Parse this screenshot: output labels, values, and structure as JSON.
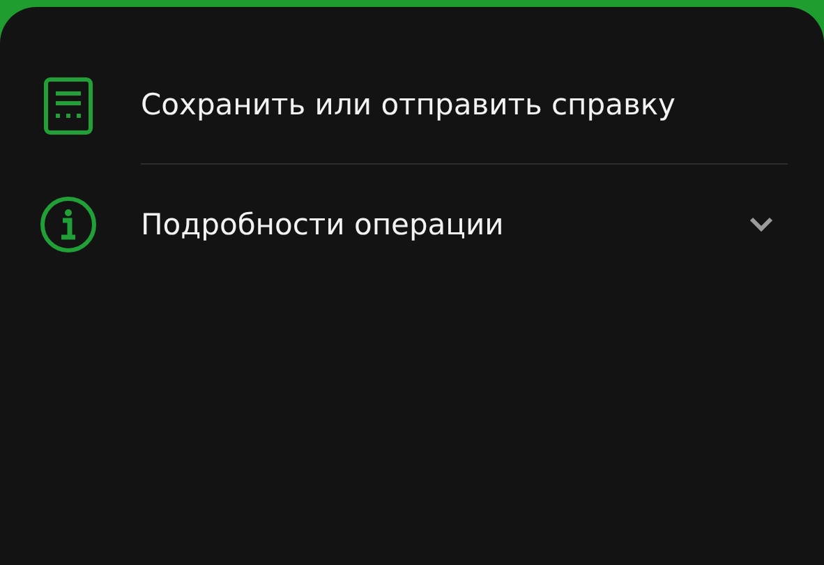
{
  "items": [
    {
      "label": "Сохранить или отправить справку",
      "kind": "action"
    },
    {
      "label": "Подробности операции",
      "kind": "expandable",
      "expanded": false
    }
  ]
}
